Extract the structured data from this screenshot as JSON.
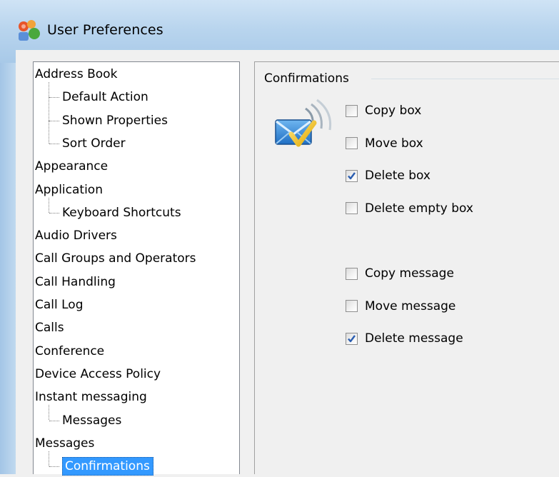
{
  "window": {
    "title": "User Preferences",
    "icon": "app-icon"
  },
  "tree": {
    "items": [
      {
        "label": "Address Book",
        "level": 0
      },
      {
        "label": "Default Action",
        "level": 1
      },
      {
        "label": "Shown Properties",
        "level": 1
      },
      {
        "label": "Sort Order",
        "level": 1
      },
      {
        "label": "Appearance",
        "level": 0
      },
      {
        "label": "Application",
        "level": 0
      },
      {
        "label": "Keyboard Shortcuts",
        "level": 1
      },
      {
        "label": "Audio Drivers",
        "level": 0
      },
      {
        "label": "Call Groups and Operators",
        "level": 0
      },
      {
        "label": "Call Handling",
        "level": 0
      },
      {
        "label": "Call Log",
        "level": 0
      },
      {
        "label": "Calls",
        "level": 0
      },
      {
        "label": "Conference",
        "level": 0
      },
      {
        "label": "Device Access Policy",
        "level": 0
      },
      {
        "label": "Instant messaging",
        "level": 0
      },
      {
        "label": "Messages",
        "level": 1
      },
      {
        "label": "Messages",
        "level": 0
      },
      {
        "label": "Confirmations",
        "level": 1,
        "selected": true
      }
    ]
  },
  "confirmations": {
    "group_title": "Confirmations",
    "icon": "mail-confirm-icon",
    "box_options": [
      {
        "label": "Copy box",
        "checked": false
      },
      {
        "label": "Move box",
        "checked": false
      },
      {
        "label": "Delete box",
        "checked": true
      },
      {
        "label": "Delete empty box",
        "checked": false
      }
    ],
    "message_options": [
      {
        "label": "Copy message",
        "checked": false
      },
      {
        "label": "Move message",
        "checked": false
      },
      {
        "label": "Delete message",
        "checked": true
      }
    ]
  },
  "colors": {
    "selection": "#3399ff",
    "titlebar": "#b9d5ee",
    "check": "#2a5db0"
  }
}
